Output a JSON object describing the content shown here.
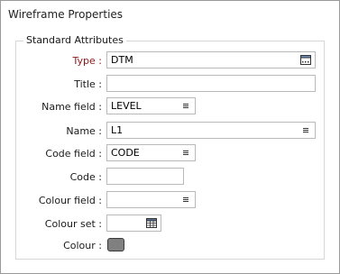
{
  "panel": {
    "title": "Wireframe Properties"
  },
  "group": {
    "title": "Standard Attributes"
  },
  "fields": {
    "type": {
      "label": "Type :",
      "value": "DTM"
    },
    "title": {
      "label": "Title :",
      "value": ""
    },
    "name_field": {
      "label": "Name field :",
      "value": "LEVEL"
    },
    "name": {
      "label": "Name :",
      "value": "L1"
    },
    "code_field": {
      "label": "Code field :",
      "value": "CODE"
    },
    "code": {
      "label": "Code :",
      "value": ""
    },
    "colour_field": {
      "label": "Colour field :",
      "value": ""
    },
    "colour_set": {
      "label": "Colour set :",
      "value": ""
    },
    "colour": {
      "label": "Colour :",
      "swatch_color": "#808080"
    }
  }
}
